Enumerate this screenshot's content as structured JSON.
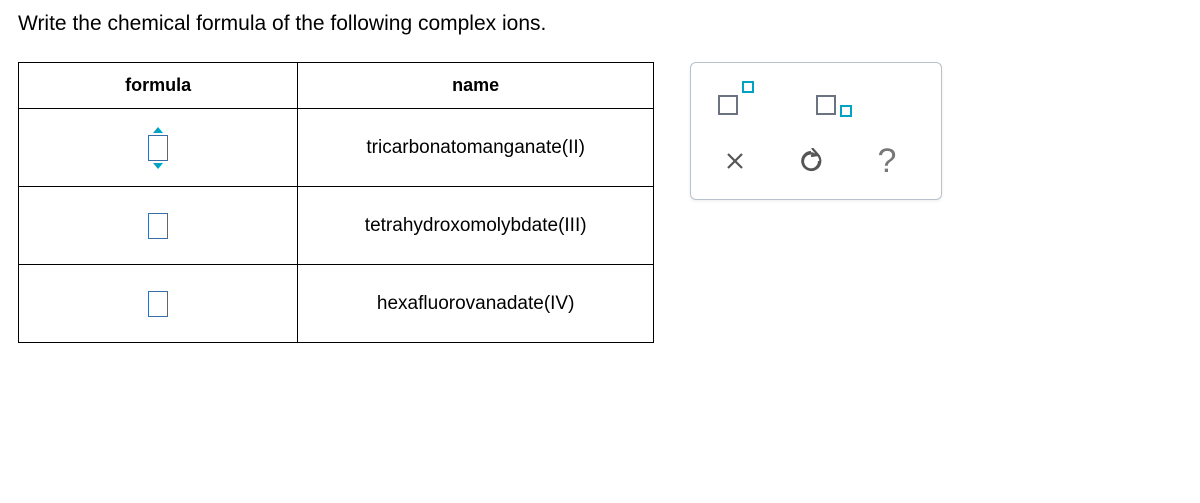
{
  "prompt": "Write the chemical formula of the following complex ions.",
  "table": {
    "headers": {
      "formula": "formula",
      "name": "name"
    },
    "rows": [
      {
        "formula": "",
        "name": "tricarbonatomanganate(II)"
      },
      {
        "formula": "",
        "name": "tetrahydroxomolybdate(III)"
      },
      {
        "formula": "",
        "name": "hexafluorovanadate(IV)"
      }
    ]
  },
  "toolbox": {
    "superscript_label": "superscript",
    "subscript_label": "subscript",
    "clear_label": "clear",
    "reset_label": "reset",
    "help_label": "?"
  }
}
